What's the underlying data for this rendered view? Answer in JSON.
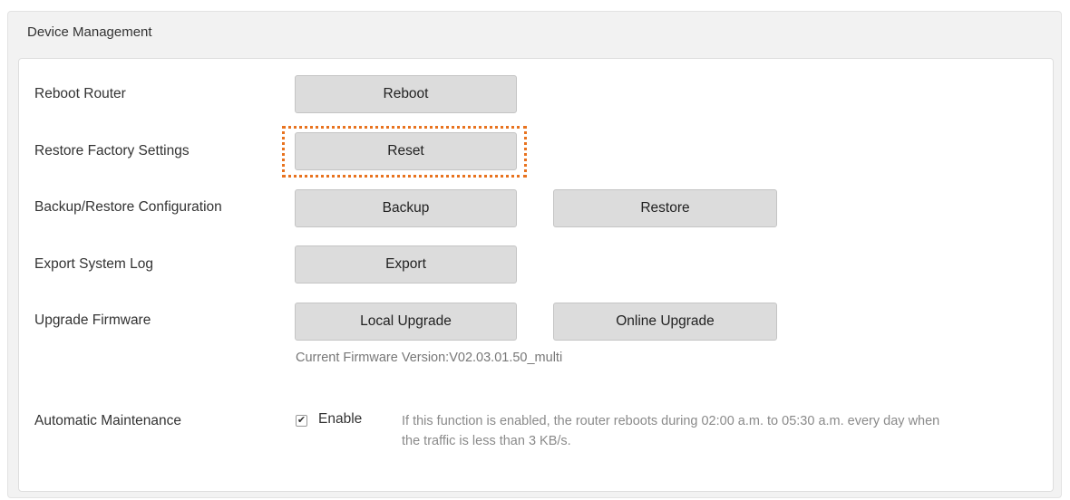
{
  "section": {
    "title": "Device Management"
  },
  "rows": {
    "reboot": {
      "label": "Reboot Router",
      "button": "Reboot"
    },
    "reset": {
      "label": "Restore Factory Settings",
      "button": "Reset"
    },
    "backup": {
      "label": "Backup/Restore Configuration",
      "backup_button": "Backup",
      "restore_button": "Restore"
    },
    "export": {
      "label": "Export System Log",
      "button": "Export"
    },
    "upgrade": {
      "label": "Upgrade Firmware",
      "local_button": "Local Upgrade",
      "online_button": "Online Upgrade",
      "version_text": "Current Firmware Version:V02.03.01.50_multi"
    },
    "maintenance": {
      "label": "Automatic Maintenance",
      "checkbox_label": "Enable",
      "checked": true,
      "description": "If this function is enabled, the router reboots during 02:00 a.m. to 05:30 a.m. every day when the traffic is less than 3 KB/s."
    }
  },
  "colors": {
    "highlight": "#e8731f",
    "button_bg": "#dcdcdc"
  }
}
